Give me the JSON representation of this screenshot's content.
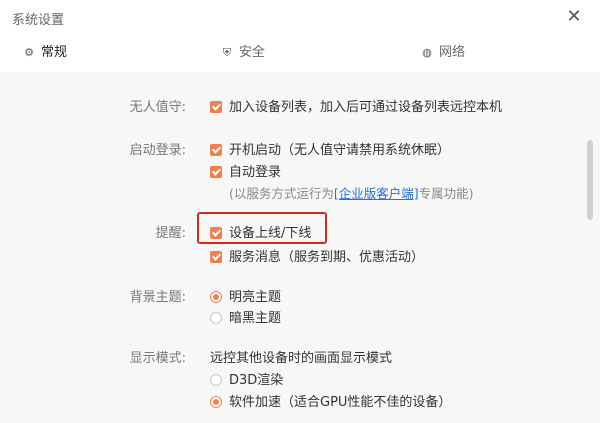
{
  "window": {
    "title": "系统设置"
  },
  "tabs": [
    {
      "label": "常规",
      "icon": "gear-icon",
      "glyph": "⚙"
    },
    {
      "label": "安全",
      "icon": "shield-icon",
      "glyph": "⛨"
    },
    {
      "label": "网络",
      "icon": "globe-icon",
      "glyph": "◍"
    }
  ],
  "settings": {
    "unattended": {
      "label": "无人值守:",
      "option": "加入设备列表，加入后可通过设备列表远控本机"
    },
    "startup": {
      "label": "启动登录:",
      "option1": "开机启动（无人值守请禁用系统休眠）",
      "option2": "自动登录",
      "note_prefix": "(以服务方式运行为",
      "note_link": "[企业版客户端]",
      "note_suffix": "专属功能)"
    },
    "reminder": {
      "label": "提醒:",
      "option1": "设备上线/下线",
      "option2": "服务消息（服务到期、优惠活动）"
    },
    "theme": {
      "label": "背景主题:",
      "option1": "明亮主题",
      "option2": "暗黑主题",
      "selected": "明亮主题"
    },
    "display": {
      "label": "显示模式:",
      "desc": "远控其他设备时的画面显示模式",
      "option1": "D3D渲染",
      "option2": "软件加速（适合GPU性能不佳的设备）",
      "selected": "软件加速（适合GPU性能不佳的设备）"
    }
  },
  "colors": {
    "accent": "#f0814d",
    "highlight": "#d9281e",
    "link": "#2a6fd6"
  }
}
